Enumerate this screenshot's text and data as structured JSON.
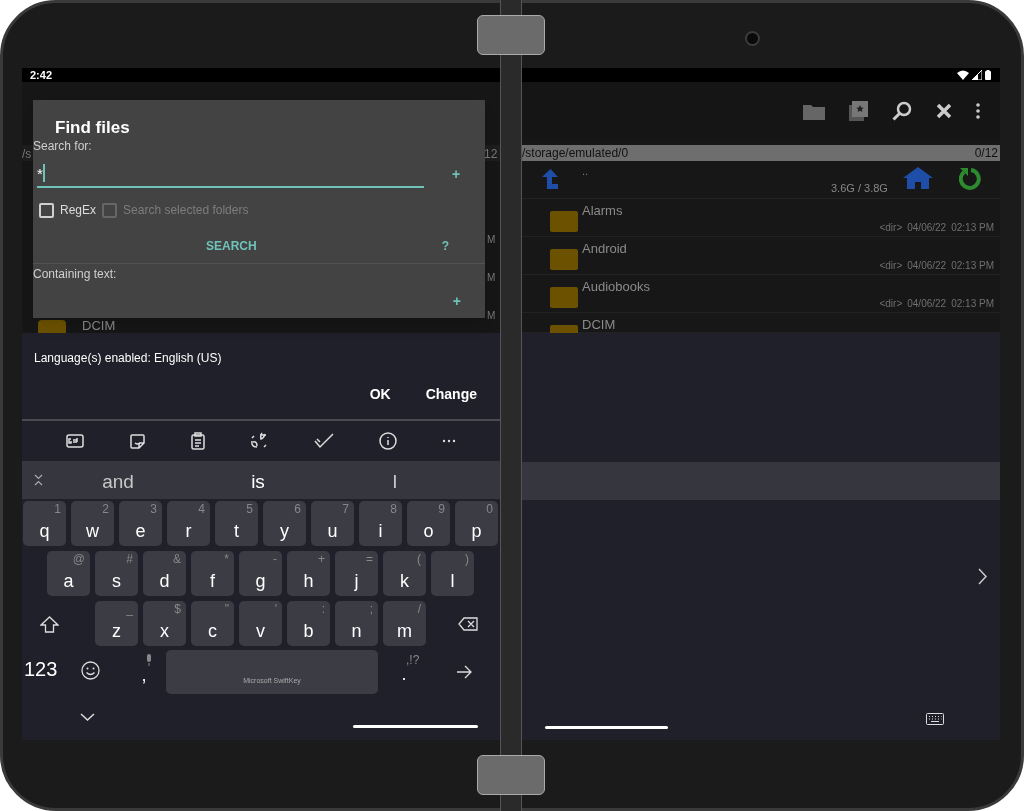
{
  "left_screen": {
    "status_bar": {
      "time": "2:42"
    },
    "background_list": {
      "path_fragment": "/s",
      "count_fragment": "12",
      "row_time_fragments": [
        "M",
        "M",
        "M"
      ],
      "last_row_name": "DCIM"
    }
  },
  "find_dialog": {
    "title": "Find files",
    "search_label": "Search for:",
    "search_value": "*",
    "add_button": "+",
    "options": [
      {
        "label": "RegEx",
        "checked": false,
        "disabled": false
      },
      {
        "label": "Search selected folders",
        "checked": false,
        "disabled": true
      }
    ],
    "search_button": "SEARCH",
    "help_button": "?",
    "containing_label": "Containing text:",
    "containing_add_button": "+"
  },
  "language_prompt": {
    "message": "Language(s) enabled: English (US)",
    "buttons": [
      "OK",
      "Change"
    ]
  },
  "keyboard": {
    "suggestions": [
      "and",
      "is",
      "I"
    ],
    "rows": [
      [
        {
          "letter": "q",
          "hint": "1"
        },
        {
          "letter": "w",
          "hint": "2"
        },
        {
          "letter": "e",
          "hint": "3"
        },
        {
          "letter": "r",
          "hint": "4"
        },
        {
          "letter": "t",
          "hint": "5"
        },
        {
          "letter": "y",
          "hint": "6"
        },
        {
          "letter": "u",
          "hint": "7"
        },
        {
          "letter": "i",
          "hint": "8"
        },
        {
          "letter": "o",
          "hint": "9"
        },
        {
          "letter": "p",
          "hint": "0"
        }
      ],
      [
        {
          "letter": "a",
          "hint": "@"
        },
        {
          "letter": "s",
          "hint": "#"
        },
        {
          "letter": "d",
          "hint": "&"
        },
        {
          "letter": "f",
          "hint": "*"
        },
        {
          "letter": "g",
          "hint": "-"
        },
        {
          "letter": "h",
          "hint": "+"
        },
        {
          "letter": "j",
          "hint": "="
        },
        {
          "letter": "k",
          "hint": "("
        },
        {
          "letter": "l",
          "hint": ")"
        }
      ],
      [
        {
          "letter": "z",
          "hint": "_"
        },
        {
          "letter": "x",
          "hint": "$"
        },
        {
          "letter": "c",
          "hint": "\""
        },
        {
          "letter": "v",
          "hint": "'"
        },
        {
          "letter": "b",
          "hint": ":"
        },
        {
          "letter": "n",
          "hint": ";"
        },
        {
          "letter": "m",
          "hint": "/"
        }
      ]
    ],
    "number_key": "123",
    "comma_key": ",",
    "space_label": "Microsoft SwiftKey",
    "period_key": ".",
    "period_hint": ",!?"
  },
  "right_screen": {
    "path": "/storage/emulated/0",
    "count": "0/12",
    "parent_row": {
      "name": "..",
      "storage": "3.6G / 3.8G"
    },
    "rows": [
      {
        "name": "Alarms",
        "type": "<dir>",
        "date": "04/06/22",
        "time": "02:13 PM"
      },
      {
        "name": "Android",
        "type": "<dir>",
        "date": "04/06/22",
        "time": "02:13 PM"
      },
      {
        "name": "Audiobooks",
        "type": "<dir>",
        "date": "04/06/22",
        "time": "02:13 PM"
      },
      {
        "name": "DCIM"
      }
    ]
  }
}
